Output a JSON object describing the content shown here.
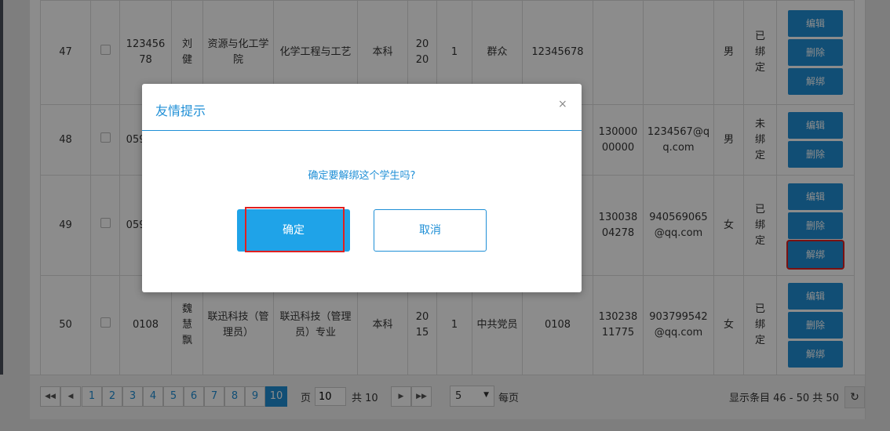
{
  "rows": [
    {
      "no": "47",
      "id": "12345678",
      "name": "刘健",
      "college": "资源与化工学院",
      "major": "化学工程与工艺",
      "level": "本科",
      "year": "2020",
      "grade": "1",
      "political": "群众",
      "cardno": "12345678",
      "phone": "",
      "email": "",
      "gender": "男",
      "status": "已绑定",
      "actions": [
        "编辑",
        "删除",
        "解绑"
      ]
    },
    {
      "no": "48",
      "id": "059108",
      "name": "",
      "college": "",
      "major": "",
      "level": "",
      "year": "",
      "grade": "",
      "political": "",
      "cardno": "",
      "phone": "13000000000",
      "email": "1234567@qq.com",
      "gender": "男",
      "status": "未绑定",
      "actions": [
        "编辑",
        "删除"
      ]
    },
    {
      "no": "49",
      "id": "059105",
      "name": "",
      "college": "",
      "major": "",
      "level": "",
      "year": "",
      "grade": "",
      "political": "",
      "cardno": "",
      "phone": "13003804278",
      "email": "940569065@qq.com",
      "gender": "女",
      "status": "已绑定",
      "actions": [
        "编辑",
        "删除",
        "解绑"
      ]
    },
    {
      "no": "50",
      "id": "0108",
      "name": "魏慧飘",
      "college": "联迅科技（管理员）",
      "major": "联迅科技（管理员）专业",
      "level": "本科",
      "year": "2015",
      "grade": "1",
      "political": "中共党员",
      "cardno": "0108",
      "phone": "13023811775",
      "email": "903799542@qq.com",
      "gender": "女",
      "status": "已绑定",
      "actions": [
        "编辑",
        "删除",
        "解绑"
      ]
    }
  ],
  "pagination": {
    "first_label": "◀◀",
    "prev_label": "◀",
    "next_label": "▶",
    "last_label": "▶▶",
    "pages": [
      "1",
      "2",
      "3",
      "4",
      "5",
      "6",
      "7",
      "8",
      "9",
      "10"
    ],
    "current_page": "10",
    "page_label": "页",
    "page_input": "10",
    "total_label": "共 10",
    "page_size": "5",
    "page_size_label": "每页",
    "summary": "显示条目 46 - 50 共 50"
  },
  "dialog": {
    "title": "友情提示",
    "close_label": "×",
    "message": "确定要解绑这个学生吗?",
    "confirm_label": "确定",
    "cancel_label": "取消"
  },
  "colors": {
    "accent": "#1f8fd6",
    "highlight": "#e02020"
  }
}
